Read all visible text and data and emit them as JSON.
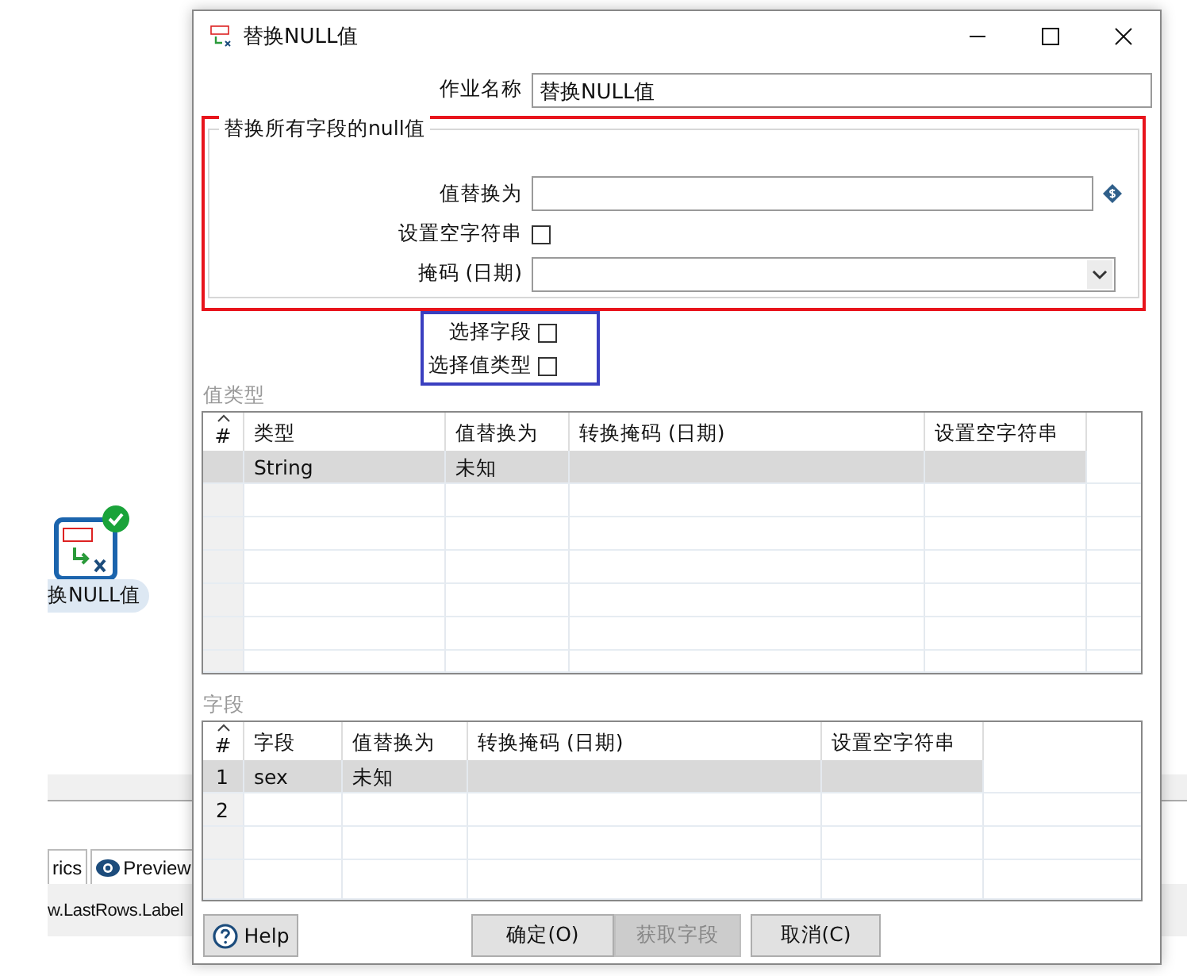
{
  "background": {
    "node": {
      "label": "换NULL值",
      "ok": true
    },
    "tabs": [
      {
        "label": "rics",
        "kind": "text"
      },
      {
        "label": "Preview",
        "kind": "eye"
      }
    ],
    "panel_text": "w.LastRows.Label"
  },
  "window": {
    "title": "替换NULL值"
  },
  "step_name": {
    "label": "作业名称",
    "value": "替换NULL值"
  },
  "all_fields_group": {
    "title": "替换所有字段的null值",
    "replace_with": {
      "label": "值替换为"
    },
    "empty_string": {
      "label": "设置空字符串",
      "checked": false
    },
    "mask": {
      "label": "掩码 (日期)"
    }
  },
  "select_fields": {
    "label": "选择字段",
    "checked": false
  },
  "select_value_types": {
    "label": "选择值类型",
    "checked": false
  },
  "value_types": {
    "title": "值类型",
    "columns": [
      "#",
      "类型",
      "值替换为",
      "转换掩码 (日期)",
      "设置空字符串"
    ],
    "rows": [
      {
        "cells": [
          "",
          "String",
          "未知",
          "",
          ""
        ],
        "selected": true
      }
    ]
  },
  "fields": {
    "title": "字段",
    "columns": [
      "#",
      "字段",
      "值替换为",
      "转换掩码 (日期)",
      "设置空字符串"
    ],
    "rows": [
      {
        "cells": [
          "1",
          "sex",
          "未知",
          "",
          ""
        ],
        "selected": true
      },
      {
        "cells": [
          "2",
          "",
          "",
          "",
          ""
        ],
        "selected": false
      }
    ]
  },
  "buttons": [
    {
      "label": "Help",
      "kind": "help",
      "disabled": false
    },
    {
      "label": "确定(O)",
      "kind": "plain",
      "disabled": false
    },
    {
      "label": "获取字段",
      "kind": "plain",
      "disabled": true
    },
    {
      "label": "取消(C)",
      "kind": "plain",
      "disabled": false
    }
  ],
  "annotations": [
    {
      "color": "#e8141c"
    },
    {
      "color": "#3a3fc0"
    }
  ]
}
